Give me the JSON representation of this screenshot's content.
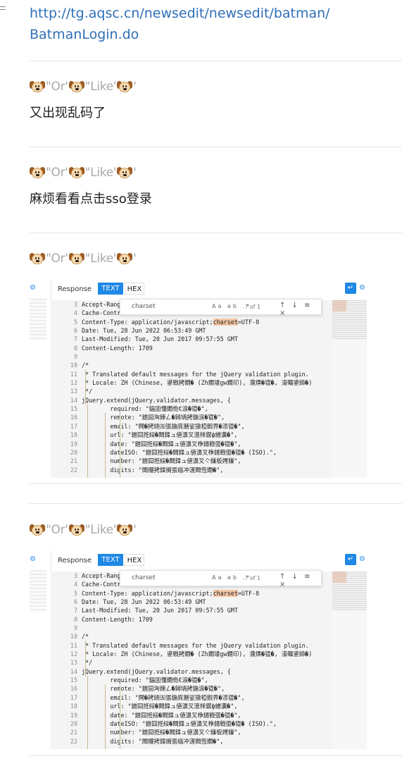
{
  "link": {
    "text": "http://tg.aqsc.cn/newsedit/newsedit/batman/BatmanLogin.do",
    "line1": "http://tg.aqsc.cn/newsedit/newsedit/batman/",
    "line2": "BatmanLogin.do"
  },
  "author": {
    "part1": "\"Or'",
    "part2": "\"Like'",
    "avatar_icon": "dog-face-icon"
  },
  "messages": [
    {
      "text": "又出现乱码了"
    },
    {
      "text": "麻烦看看点击sso登录"
    },
    {
      "text": ""
    },
    {
      "text": ""
    }
  ],
  "screenshot": {
    "response_label": "Response",
    "tab_text": "TEXT",
    "tab_hex": "HEX",
    "search_query": "charset",
    "search_options": "Aa ab .*",
    "search_count": "? of 1",
    "search_nav": "↑ ↓ ≡ ×",
    "line_numbers": [
      "3",
      "4",
      "5",
      "6",
      "7",
      "8",
      "9",
      "10",
      "11",
      "12",
      "13",
      "14",
      "15",
      "16",
      "17",
      "18",
      "19",
      "20",
      "21",
      "22"
    ],
    "lines": [
      "Accept-Ranges: bytes",
      "Cache-Control: no-cache",
      "Content-Type: application/javascript;",
      "Date: Tue, 28 Jun 2022 06:53:49 GMT",
      "Last-Modified: Tue, 20 Jun 2017 09:57:55 GMT",
      "Content-Length: 1709",
      "",
      "/*",
      " * Translated default messages for the jQuery validation plugin.",
      " * Locale: ZH (Chinese, 鍙戦拷鐗� (Zh鐗堟gw鐗印), 濮熼�锟�, 濠曞鍙鍗�)",
      " */",
      "jQuery.extend(jQuery.validator.messages, {",
      "        required: \"鍢囬懂鐗佹€涙�锟�\",",
      "        remote: \"鐠囩洶鍊ㄥ�鐞堝拷鍦涙�锟�\",",
      "        email: \"闁�拷娆㈤張鍦庣磿娑撴椏鍜界�涢锟�\",",
      "        url: \"鐠囧拰綏�閸鍏ュ値濞叉澶柇鍥ф繒瀵�\",",
      "        date: \"鐠囧拰綏�閸鍏ュ値濞叉棦鍚戦弬�锟�\",",
      "        dateISO: \"鐠囧拰綏�閸鍏ュ値濞叉棦鍚戦弬�锟� (ISO).\",",
      "        number: \"鐠囧拰綏�閸鍏ュ値濞叉亽鏁板嫮鏁\",",
      "        digits: \"閸欏拷鍏搁張缁冲湹閸恆鐗�\","
    ],
    "charset_label": "charset",
    "charset_value": "=UTF-8"
  }
}
